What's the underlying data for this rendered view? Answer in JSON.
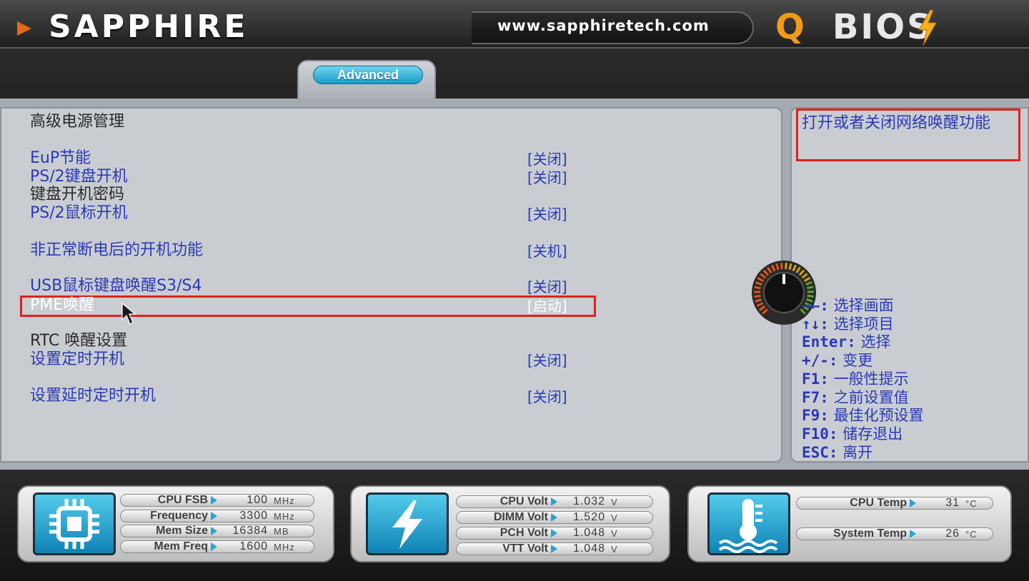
{
  "header": {
    "brand": "SAPPHIRE",
    "url": "www.sapphiretech.com",
    "logo_q": "Q",
    "logo_rest": "BIOS"
  },
  "tabs": [
    {
      "label": "Advanced"
    }
  ],
  "main": {
    "title": "高级电源管理",
    "items": [
      {
        "label": "EuP节能",
        "value": "[关闭]"
      },
      {
        "label": "PS/2键盘开机",
        "value": "[关闭]"
      },
      {
        "label": "键盘开机密码",
        "value": ""
      },
      {
        "label": "PS/2鼠标开机",
        "value": "[关闭]"
      },
      {
        "label": "非正常断电后的开机功能",
        "value": "[关机]"
      },
      {
        "label": "USB鼠标键盘唤醒S3/S4",
        "value": "[关闭]"
      },
      {
        "label": "PME唤醒",
        "value": "[启动]"
      },
      {
        "label": "RTC 唤醒设置",
        "value": ""
      },
      {
        "label": "设置定时开机",
        "value": "[关闭]"
      },
      {
        "label": "设置延时定时开机",
        "value": "[关闭]"
      }
    ]
  },
  "help": {
    "text": "打开或者关闭网络唤醒功能",
    "keys": [
      {
        "key": "→←:",
        "desc": "选择画面"
      },
      {
        "key": "↑↓:",
        "desc": "选择项目"
      },
      {
        "key": "Enter:",
        "desc": "选择"
      },
      {
        "key": "+/-:",
        "desc": "变更"
      },
      {
        "key": "F1:",
        "desc": "一般性提示"
      },
      {
        "key": "F7:",
        "desc": "之前设置值"
      },
      {
        "key": "F9:",
        "desc": "最佳化预设置"
      },
      {
        "key": "F10:",
        "desc": "储存退出"
      },
      {
        "key": "ESC:",
        "desc": "离开"
      }
    ]
  },
  "status": {
    "cpu": [
      {
        "label": "CPU FSB",
        "value": "100",
        "unit": "MHz"
      },
      {
        "label": "Frequency",
        "value": "3300",
        "unit": "MHz"
      },
      {
        "label": "Mem Size",
        "value": "16384",
        "unit": "MB"
      },
      {
        "label": "Mem Freq",
        "value": "1600",
        "unit": "MHz"
      }
    ],
    "volt": [
      {
        "label": "CPU Volt",
        "value": "1.032",
        "unit": "V"
      },
      {
        "label": "DIMM Volt",
        "value": "1.520",
        "unit": "V"
      },
      {
        "label": "PCH Volt",
        "value": "1.048",
        "unit": "V"
      },
      {
        "label": "VTT Volt",
        "value": "1.048",
        "unit": "V"
      }
    ],
    "temp": [
      {
        "label": "CPU Temp",
        "value": "31",
        "unit": "°C"
      },
      {
        "label": "System Temp",
        "value": "26",
        "unit": "°C"
      }
    ]
  },
  "colors": {
    "accent_blue": "#2b39b5",
    "highlight_red": "#e0201e",
    "icon_cyan": "#2aa3d3",
    "brand_orange": "#e46a1a"
  }
}
